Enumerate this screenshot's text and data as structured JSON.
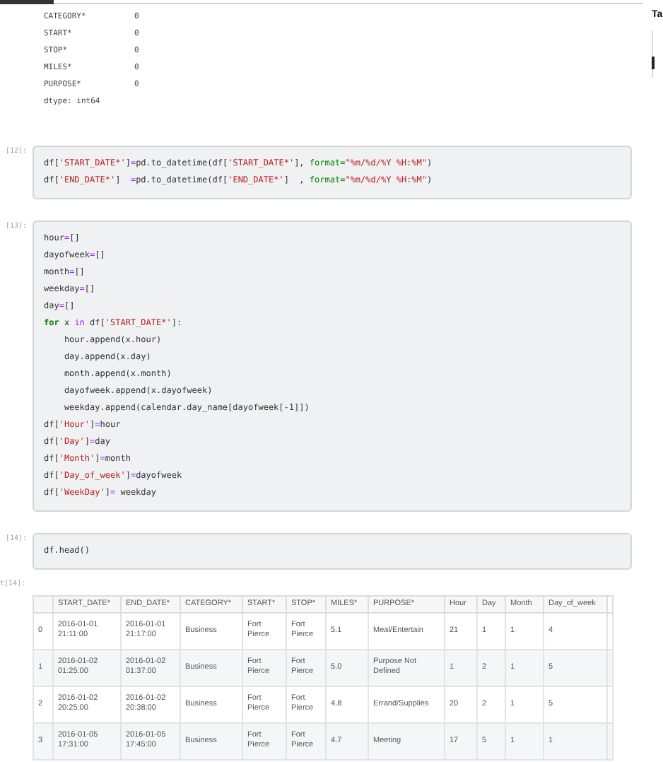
{
  "side_panel": {
    "title": "Ta"
  },
  "output_series": [
    {
      "name": "CATEGORY*",
      "value": "0"
    },
    {
      "name": "START*",
      "value": "0"
    },
    {
      "name": "STOP*",
      "value": "0"
    },
    {
      "name": "MILES*",
      "value": "0"
    },
    {
      "name": "PURPOSE*",
      "value": "0"
    }
  ],
  "dtype": "dtype: int64",
  "cells": [
    {
      "prompt": "[12]:",
      "lines": [
        [
          {
            "text": "df[",
            "kind": "plain"
          },
          {
            "text": "'START_DATE*'",
            "kind": "string"
          },
          {
            "text": "]",
            "kind": "plain"
          },
          {
            "text": "=",
            "kind": "operator"
          },
          {
            "text": "pd.to_datetime(df[",
            "kind": "plain"
          },
          {
            "text": "'START_DATE*'",
            "kind": "string"
          },
          {
            "text": "], ",
            "kind": "plain"
          },
          {
            "text": "format=",
            "kind": "argument"
          },
          {
            "text": "\"%m/%d/%Y %H:%M\"",
            "kind": "string"
          },
          {
            "text": ")",
            "kind": "plain"
          }
        ],
        [
          {
            "text": "df[",
            "kind": "plain"
          },
          {
            "text": "'END_DATE*'",
            "kind": "string"
          },
          {
            "text": "]  ",
            "kind": "plain"
          },
          {
            "text": "=",
            "kind": "operator"
          },
          {
            "text": "pd.to_datetime(df[",
            "kind": "plain"
          },
          {
            "text": "'END_DATE*'",
            "kind": "string"
          },
          {
            "text": "]  , ",
            "kind": "plain"
          },
          {
            "text": "format=",
            "kind": "argument"
          },
          {
            "text": "\"%m/%d/%Y %H:%M\"",
            "kind": "string"
          },
          {
            "text": ")",
            "kind": "plain"
          }
        ]
      ]
    },
    {
      "prompt": "[13]:",
      "lines": [
        [
          {
            "text": "hour",
            "kind": "plain"
          },
          {
            "text": "=",
            "kind": "operator"
          },
          {
            "text": "[]",
            "kind": "plain"
          }
        ],
        [
          {
            "text": "dayofweek",
            "kind": "plain"
          },
          {
            "text": "=",
            "kind": "operator"
          },
          {
            "text": "[]",
            "kind": "plain"
          }
        ],
        [
          {
            "text": "month",
            "kind": "plain"
          },
          {
            "text": "=",
            "kind": "operator"
          },
          {
            "text": "[]",
            "kind": "plain"
          }
        ],
        [
          {
            "text": "weekday",
            "kind": "plain"
          },
          {
            "text": "=",
            "kind": "operator"
          },
          {
            "text": "[]",
            "kind": "plain"
          }
        ],
        [
          {
            "text": "day",
            "kind": "plain"
          },
          {
            "text": "=",
            "kind": "operator"
          },
          {
            "text": "[]",
            "kind": "plain"
          }
        ],
        [
          {
            "text": "for",
            "kind": "keyword"
          },
          {
            "text": " x ",
            "kind": "plain"
          },
          {
            "text": "in",
            "kind": "operator"
          },
          {
            "text": " df[",
            "kind": "plain"
          },
          {
            "text": "'START_DATE*'",
            "kind": "string"
          },
          {
            "text": "]:",
            "kind": "plain"
          }
        ],
        [
          {
            "text": "    hour.append(x.hour)",
            "kind": "plain"
          }
        ],
        [
          {
            "text": "    day.append(x.day)",
            "kind": "plain"
          }
        ],
        [
          {
            "text": "    month.append(x.month)",
            "kind": "plain"
          }
        ],
        [
          {
            "text": "    dayofweek.append(x.dayofweek)",
            "kind": "plain"
          }
        ],
        [
          {
            "text": "    weekday.append(calendar.day_name[dayofweek[-1]])",
            "kind": "plain"
          }
        ],
        [
          {
            "text": "df[",
            "kind": "plain"
          },
          {
            "text": "'Hour'",
            "kind": "string"
          },
          {
            "text": "]",
            "kind": "plain"
          },
          {
            "text": "=",
            "kind": "operator"
          },
          {
            "text": "hour",
            "kind": "plain"
          }
        ],
        [
          {
            "text": "df[",
            "kind": "plain"
          },
          {
            "text": "'Day'",
            "kind": "string"
          },
          {
            "text": "]",
            "kind": "plain"
          },
          {
            "text": "=",
            "kind": "operator"
          },
          {
            "text": "day",
            "kind": "plain"
          }
        ],
        [
          {
            "text": "df[",
            "kind": "plain"
          },
          {
            "text": "'Month'",
            "kind": "string"
          },
          {
            "text": "]",
            "kind": "plain"
          },
          {
            "text": "=",
            "kind": "operator"
          },
          {
            "text": "month",
            "kind": "plain"
          }
        ],
        [
          {
            "text": "df[",
            "kind": "plain"
          },
          {
            "text": "'Day_of_week'",
            "kind": "string"
          },
          {
            "text": "]",
            "kind": "plain"
          },
          {
            "text": "=",
            "kind": "operator"
          },
          {
            "text": "dayofweek",
            "kind": "plain"
          }
        ],
        [
          {
            "text": "df[",
            "kind": "plain"
          },
          {
            "text": "'WeekDay'",
            "kind": "string"
          },
          {
            "text": "]",
            "kind": "plain"
          },
          {
            "text": "=",
            "kind": "operator"
          },
          {
            "text": " weekday",
            "kind": "plain"
          }
        ]
      ]
    },
    {
      "prompt": "[14]:",
      "lines": [
        [
          {
            "text": "df.head()",
            "kind": "plain"
          }
        ]
      ]
    }
  ],
  "out_prompt": "t[14]:",
  "table": {
    "columns": [
      "",
      "START_DATE*",
      "END_DATE*",
      "CATEGORY*",
      "START*",
      "STOP*",
      "MILES*",
      "PURPOSE*",
      "Hour",
      "Day",
      "Month",
      "Day_of_week"
    ],
    "rows": [
      [
        "0",
        "2016-01-01 21:11:00",
        "2016-01-01 21:17:00",
        "Business",
        "Fort Pierce",
        "Fort Pierce",
        "5.1",
        "Meal/Entertain",
        "21",
        "1",
        "1",
        "4"
      ],
      [
        "1",
        "2016-01-02 01:25:00",
        "2016-01-02 01:37:00",
        "Business",
        "Fort Pierce",
        "Fort Pierce",
        "5.0",
        "Purpose Not Defined",
        "1",
        "2",
        "1",
        "5"
      ],
      [
        "2",
        "2016-01-02 20:25:00",
        "2016-01-02 20:38:00",
        "Business",
        "Fort Pierce",
        "Fort Pierce",
        "4.8",
        "Errand/Supplies",
        "20",
        "2",
        "1",
        "5"
      ],
      [
        "3",
        "2016-01-05 17:31:00",
        "2016-01-05 17:45:00",
        "Business",
        "Fort Pierce",
        "Fort Pierce",
        "4.7",
        "Meeting",
        "17",
        "5",
        "1",
        "1"
      ]
    ]
  }
}
